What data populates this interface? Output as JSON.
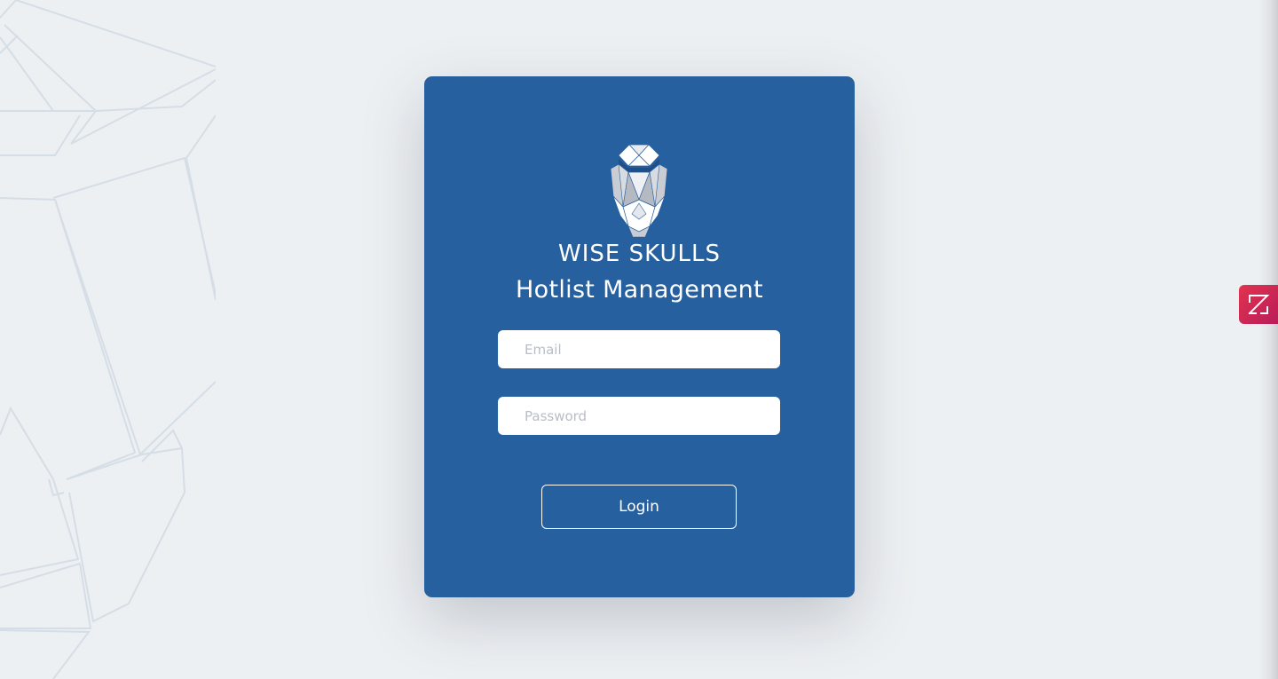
{
  "brand": {
    "name": "WISE SKULLS",
    "logo_icon": "geometric-skull-icon"
  },
  "app_title": "Hotlist Management",
  "form": {
    "email_placeholder": "Email",
    "email_value": "",
    "password_placeholder": "Password",
    "password_value": "",
    "login_label": "Login"
  },
  "side_widget": {
    "icon": "zoho-z-icon"
  },
  "colors": {
    "background": "#edf0f3",
    "card": "#27609f",
    "text_on_card": "#ffffff",
    "placeholder": "#b8bdc6",
    "widget_start": "#e2334f",
    "widget_end": "#b91c5a"
  }
}
